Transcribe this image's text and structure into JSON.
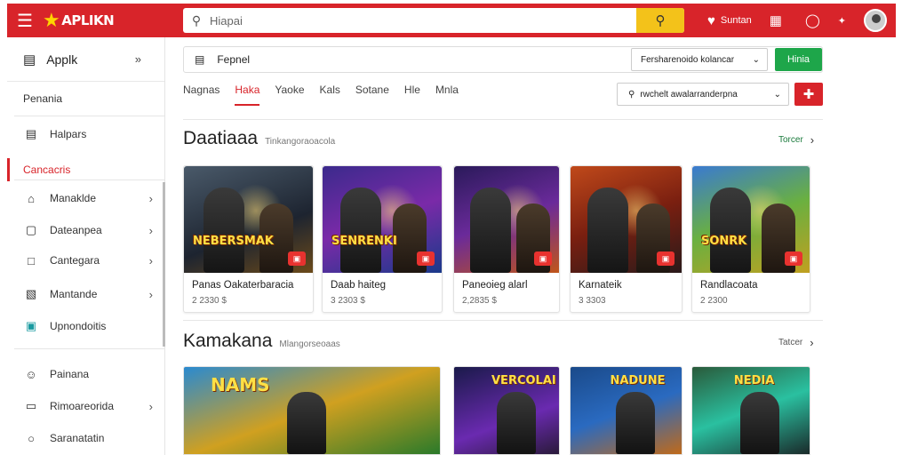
{
  "header": {
    "app_name": "APLIKN",
    "search_placeholder": "Hiapai",
    "signin_label": "Suntan",
    "menu_icon": "hamburger-icon",
    "search_icon": "search-icon",
    "accent_color": "#d8242a",
    "search_button_color": "#f3c21a"
  },
  "sidebar": {
    "title": "Applk",
    "items": [
      {
        "label": "Penania",
        "icon": "",
        "chevron": false,
        "active": false
      },
      {
        "label": "Halpars",
        "icon": "panel-icon",
        "chevron": false,
        "active": false
      },
      {
        "label": "Cancacris",
        "icon": "",
        "chevron": false,
        "active": true
      },
      {
        "label": "Manaklde",
        "icon": "home-icon",
        "chevron": true,
        "active": false
      },
      {
        "label": "Dateanpea",
        "icon": "tag-icon",
        "chevron": true,
        "active": false
      },
      {
        "label": "Cantegara",
        "icon": "square-icon",
        "chevron": true,
        "active": false
      },
      {
        "label": "Mantande",
        "icon": "image-icon",
        "chevron": true,
        "active": false
      },
      {
        "label": "Upnondoitis",
        "icon": "folder-icon",
        "chevron": false,
        "active": false
      },
      {
        "label": "Painana",
        "icon": "user-icon",
        "chevron": false,
        "active": false
      },
      {
        "label": "Rimoareorida",
        "icon": "card-icon",
        "chevron": true,
        "active": false
      },
      {
        "label": "Saranatatin",
        "icon": "circle-icon",
        "chevron": false,
        "active": false
      }
    ]
  },
  "toolbar": {
    "filter_label": "Fepnel",
    "dropdown1_value": "Fersharenoido kolancar",
    "green_button": "Hinia",
    "sort_value": "rwchelt awalarranderpna",
    "green_color": "#1ea64a"
  },
  "tabs": [
    "Nagnas",
    "Haka",
    "Yaoke",
    "Kals",
    "Sotane",
    "Hle",
    "Mnla"
  ],
  "active_tab": 1,
  "sections": [
    {
      "title": "Daatiaaa",
      "subtitle": "Tinkangoraoacola",
      "see_all": "Torcer"
    },
    {
      "title": "Kamakana",
      "subtitle": "Mlangorseoaas",
      "see_all": "Tatcer"
    }
  ],
  "cards": [
    {
      "title": "Panas Oakaterbaracia",
      "meta": "2 2330  $",
      "art": "NEBERSMAK"
    },
    {
      "title": "Daab haiteg",
      "meta": "3 2303  $",
      "art": "SENRENKI"
    },
    {
      "title": "Paneoieg alarl",
      "meta": "2,2835  $",
      "art": ""
    },
    {
      "title": "Karnateik",
      "meta": "3 3303",
      "art": ""
    },
    {
      "title": "Randlacoata",
      "meta": "2 2300",
      "art": "SONRK"
    }
  ],
  "row2_art": [
    "NAMS",
    "VERCOLAI",
    "NADUNE",
    "NEDIA"
  ]
}
